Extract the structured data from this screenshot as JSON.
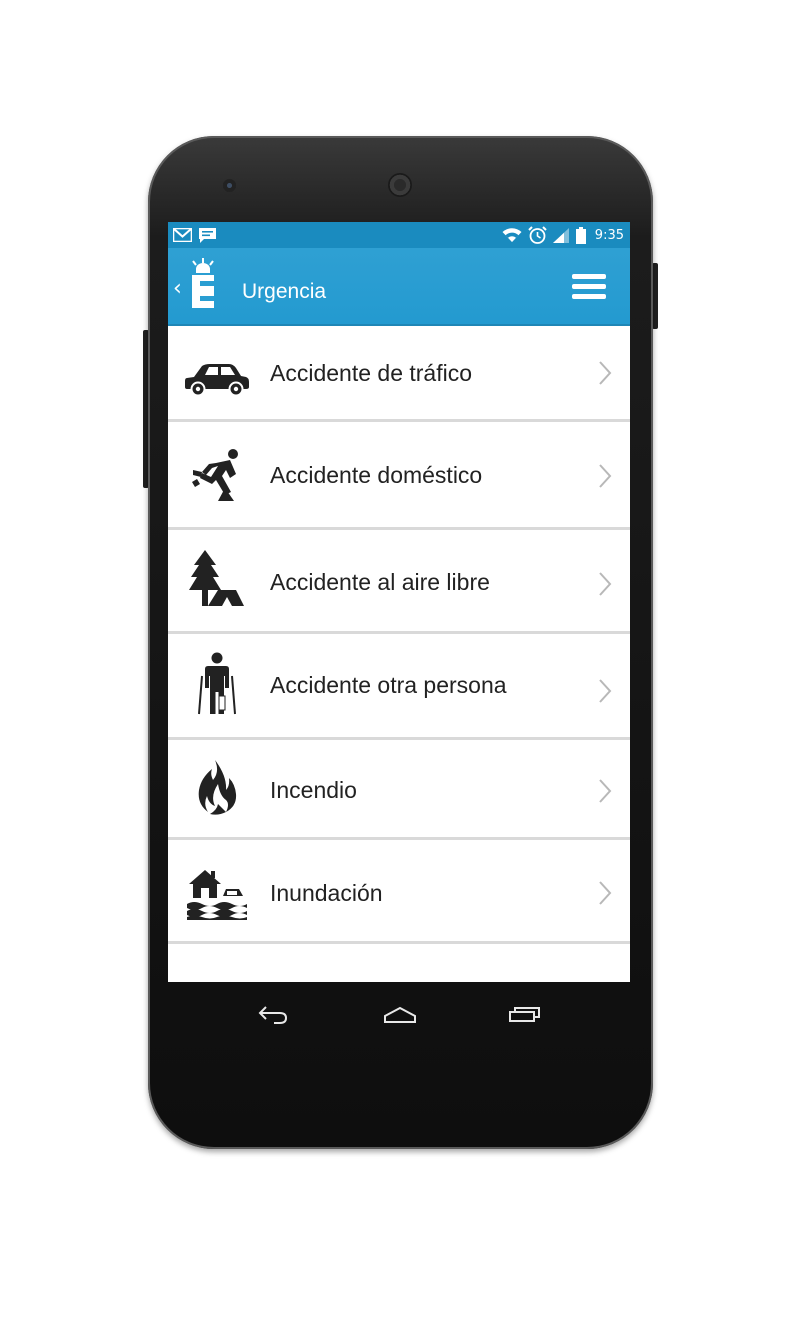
{
  "status_bar": {
    "time": "9:35",
    "notification_icons": [
      "gmail-icon",
      "message-icon"
    ],
    "system_icons": [
      "wifi-icon",
      "alarm-icon",
      "signal-icon",
      "battery-icon"
    ]
  },
  "app_bar": {
    "title": "Urgencia",
    "logo_letter": "E",
    "background": "#239ad0"
  },
  "list": {
    "items": [
      {
        "label": "Accidente de tráfico",
        "icon": "car-icon"
      },
      {
        "label": "Accidente doméstico",
        "icon": "tripping-person-icon"
      },
      {
        "label": "Accidente al aire libre",
        "icon": "tree-tent-icon"
      },
      {
        "label": "Accidente otra persona",
        "icon": "person-crutches-icon"
      },
      {
        "label": "Incendio",
        "icon": "fire-icon"
      },
      {
        "label": "Inundación",
        "icon": "flood-house-icon"
      }
    ]
  },
  "nav_bar": {
    "buttons": [
      "back-icon",
      "home-icon",
      "recent-apps-icon"
    ]
  },
  "colors": {
    "accent": "#239ad0",
    "status_bar": "#1a8bbf",
    "divider": "#d9d9d9",
    "text": "#222222"
  }
}
